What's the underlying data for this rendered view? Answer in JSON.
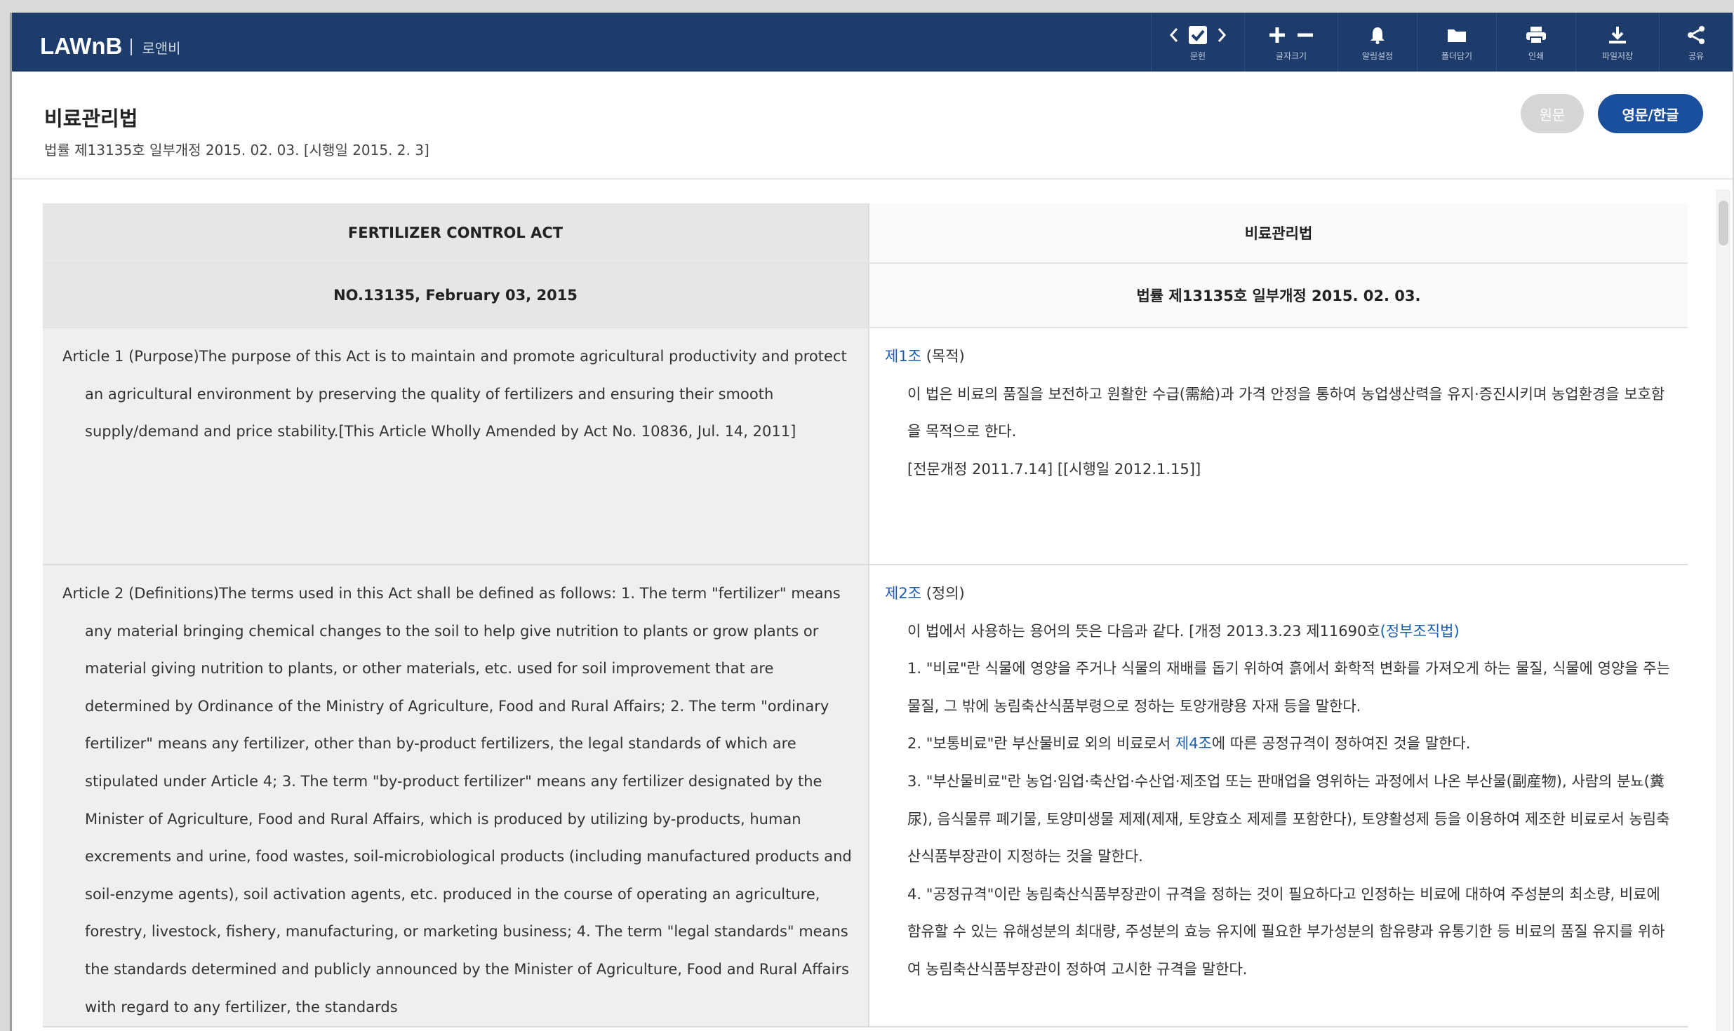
{
  "app": {
    "logo": "LAWnB",
    "logo_small": "",
    "service": "로앤비"
  },
  "toolbar": {
    "items": [
      {
        "label": "문헌",
        "icon": "checkbox-nav-icon"
      },
      {
        "label": "글자크기",
        "icon": "font-size-icon"
      },
      {
        "label": "알림설정",
        "icon": "bell-icon"
      },
      {
        "label": "폴더담기",
        "icon": "folder-icon"
      },
      {
        "label": "인쇄",
        "icon": "print-icon"
      },
      {
        "label": "파일저장",
        "icon": "download-icon"
      },
      {
        "label": "공유",
        "icon": "share-icon"
      }
    ]
  },
  "document": {
    "title": "비료관리법",
    "subtitle": "법률 제13135호 일부개정 2015. 02. 03. [시행일 2015. 2. 3]",
    "view_buttons": {
      "original": "원문",
      "both": "영문/한글"
    }
  },
  "table": {
    "header_en": "FERTILIZER CONTROL ACT",
    "header_ko": "비료관리법",
    "sub_en": "NO.13135, February 03, 2015",
    "sub_ko": "법률 제13135호 일부개정 2015. 02. 03.",
    "article1": {
      "en": "Article 1 (Purpose)The purpose of this Act is to maintain and promote agricultural productivity and protect an agricultural environment by preserving the quality of fertilizers and ensuring their smooth supply/demand and price stability.[This Article Wholly Amended by Act No. 10836, Jul. 14, 2011]",
      "ko_no": "제1조",
      "ko_title": "(목적)",
      "ko_body": "이 법은 비료의 품질을 보전하고 원활한 수급(需給)과 가격 안정을 통하여 농업생산력을 유지·증진시키며 농업환경을 보호함을 목적으로 한다.",
      "ko_note": "[전문개정 2011.7.14] [[시행일 2012.1.15]]"
    },
    "article2": {
      "en": "Article 2 (Definitions)The terms used in this Act shall be defined as follows: 1. The term \"fertilizer\" means any material bringing chemical changes to the soil to help give nutrition to plants or grow plants or material giving nutrition to plants, or other materials, etc. used for soil improvement that are determined by Ordinance of the Ministry of Agriculture, Food and Rural Affairs; 2. The term \"ordinary fertilizer\" means any fertilizer, other than by-product fertilizers, the legal standards of which are stipulated under Article 4; 3. The term \"by-product fertilizer\" means any fertilizer designated by the Minister of Agriculture, Food and Rural Affairs, which is produced by utilizing by-products, human excrements and urine, food wastes, soil-microbiological products (including manufactured products and soil-enzyme agents), soil activation agents, etc. produced in the course of operating an agriculture, forestry, livestock, fishery, manufacturing, or marketing business; 4. The term \"legal standards\" means the standards determined and publicly announced by the Minister of Agriculture, Food and Rural Affairs with regard to any fertilizer, the standards",
      "ko_no": "제2조",
      "ko_title": "(정의)",
      "ko_intro": "이 법에서 사용하는 용어의 뜻은 다음과 같다. [개정 2013.3.23 제11690호",
      "ko_intro_link": "(정부조직법)",
      "ko_item1": "1. \"비료\"란 식물에 영양을 주거나 식물의 재배를 돕기 위하여 흙에서 화학적 변화를 가져오게 하는 물질, 식물에 영양을 주는 물질, 그 밖에 농림축산식품부령으로 정하는 토양개량용 자재 등을 말한다.",
      "ko_item2_a": "2. \"보통비료\"란 부산물비료 외의 비료로서",
      "ko_item2_link": "제4조",
      "ko_item2_b": "에 따른 공정규격이 정하여진 것을 말한다.",
      "ko_item3": "3. \"부산물비료\"란 농업·임업·축산업·수산업·제조업 또는 판매업을 영위하는 과정에서 나온 부산물(副産物), 사람의 분뇨(糞尿), 음식물류 폐기물, 토양미생물 제제(제재, 토양효소 제제를 포함한다), 토양활성제 등을 이용하여 제조한 비료로서 농림축산식품부장관이 지정하는 것을 말한다.",
      "ko_item4": "4. \"공정규격\"이란 농림축산식품부장관이 규격을 정하는 것이 필요하다고 인정하는 비료에 대하여 주성분의 최소량, 비료에 함유할 수 있는 유해성분의 최대량, 주성분의 효능 유지에 필요한 부가성분의 함유량과 유통기한 등 비료의 품질 유지를 위하여 농림축산식품부장관이 정하여 고시한 규격을 말한다."
    }
  },
  "colors": {
    "topbar": "#1d3c6b",
    "accent_button": "#1a4f9e",
    "link": "#1a5fb4"
  }
}
